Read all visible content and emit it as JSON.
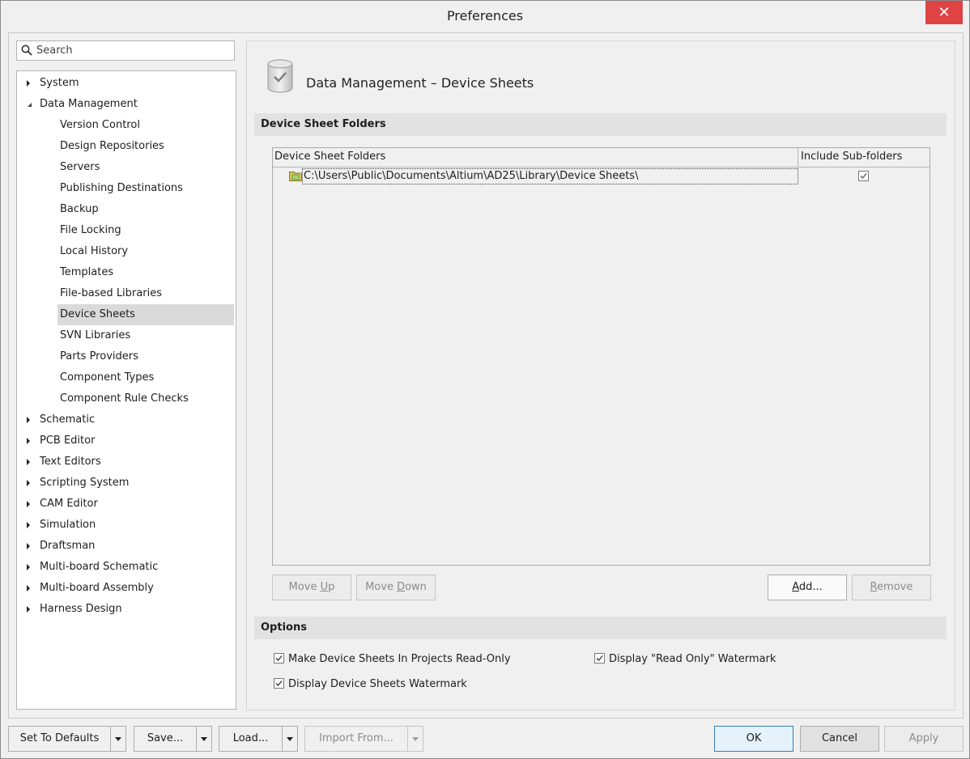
{
  "window": {
    "title": "Preferences",
    "close_glyph": "✕"
  },
  "search": {
    "placeholder": "Search",
    "icon": "search-icon"
  },
  "tree": {
    "top_items": [
      {
        "label": "System",
        "expanded": false
      },
      {
        "label": "Data Management",
        "expanded": true
      },
      {
        "label": "Schematic",
        "expanded": false
      },
      {
        "label": "PCB Editor",
        "expanded": false
      },
      {
        "label": "Text Editors",
        "expanded": false
      },
      {
        "label": "Scripting System",
        "expanded": false
      },
      {
        "label": "CAM Editor",
        "expanded": false
      },
      {
        "label": "Simulation",
        "expanded": false
      },
      {
        "label": "Draftsman",
        "expanded": false
      },
      {
        "label": "Multi-board Schematic",
        "expanded": false
      },
      {
        "label": "Multi-board Assembly",
        "expanded": false
      },
      {
        "label": "Harness Design",
        "expanded": false
      }
    ],
    "data_management_children": [
      "Version Control",
      "Design Repositories",
      "Servers",
      "Publishing Destinations",
      "Backup",
      "File Locking",
      "Local History",
      "Templates",
      "File-based Libraries",
      "Device Sheets",
      "SVN Libraries",
      "Parts Providers",
      "Component Types",
      "Component Rule Checks"
    ],
    "selected": "Device Sheets"
  },
  "page": {
    "title": "Data Management – Device Sheets",
    "icon": "database-check-icon"
  },
  "folders_section": {
    "header": "Device Sheet Folders",
    "columns": [
      "Device Sheet Folders",
      "Include Sub-folders"
    ],
    "rows": [
      {
        "path": "C:\\Users\\Public\\Documents\\Altium\\AD25\\Library\\Device Sheets\\",
        "include_subfolders": true,
        "icon": "folder-icon"
      }
    ],
    "buttons": {
      "move_up": {
        "pre": "Move ",
        "key": "U",
        "post": "p",
        "enabled": false
      },
      "move_down": {
        "pre": "Move ",
        "key": "D",
        "post": "own",
        "enabled": false
      },
      "add": {
        "pre": "",
        "key": "A",
        "post": "dd...",
        "enabled": true
      },
      "remove": {
        "pre": "",
        "key": "R",
        "post": "emove",
        "enabled": false
      }
    }
  },
  "options_section": {
    "header": "Options",
    "options": [
      {
        "label": "Make Device Sheets In Projects Read-Only",
        "checked": true
      },
      {
        "label": "Display \"Read Only\" Watermark",
        "checked": true
      },
      {
        "label": "Display Device Sheets Watermark",
        "checked": true
      }
    ]
  },
  "footer": {
    "set_to_defaults": "Set To Defaults",
    "save": "Save...",
    "load": "Load...",
    "import_from": "Import From...",
    "ok": "OK",
    "cancel": "Cancel",
    "apply": "Apply"
  },
  "colors": {
    "close_button": "#e04343",
    "selected_row": "#dadada",
    "section_header": "#e2e2e2",
    "primary_border": "#3c7fb1"
  }
}
